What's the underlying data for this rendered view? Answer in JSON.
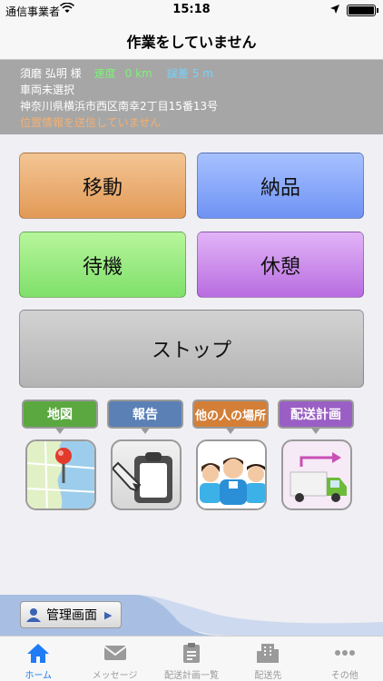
{
  "status_bar": {
    "carrier": "通信事業者",
    "time": "15:18"
  },
  "nav": {
    "title": "作業をしていません"
  },
  "info": {
    "name": "須磨 弘明 様",
    "speed_label": "速度",
    "speed_value": "0 km",
    "error_label": "誤差",
    "error_value": "5 m",
    "vehicle": "車両未選択",
    "address": "神奈川県横浜市西区南幸2丁目15番13号",
    "location_status": "位置情報を送信していません"
  },
  "actions": {
    "move": "移動",
    "deliver": "納品",
    "wait": "待機",
    "rest": "休憩",
    "stop": "ストップ"
  },
  "tiles": [
    {
      "label": "地図",
      "color": "#5aa83f",
      "icon": "map-icon"
    },
    {
      "label": "報告",
      "color": "#5b80b6",
      "icon": "report-icon"
    },
    {
      "label": "他の人の場所",
      "color": "#d37f37",
      "icon": "people-icon"
    },
    {
      "label": "配送計画",
      "color": "#9a5fc4",
      "icon": "truck-icon"
    }
  ],
  "management": {
    "label": "管理画面"
  },
  "tabs": [
    {
      "label": "ホーム",
      "icon": "home-icon",
      "active": true
    },
    {
      "label": "メッセージ",
      "icon": "envelope-icon",
      "active": false
    },
    {
      "label": "配送計画一覧",
      "icon": "clipboard-icon",
      "active": false
    },
    {
      "label": "配送先",
      "icon": "building-icon",
      "active": false
    },
    {
      "label": "その他",
      "icon": "more-icon",
      "active": false
    }
  ]
}
